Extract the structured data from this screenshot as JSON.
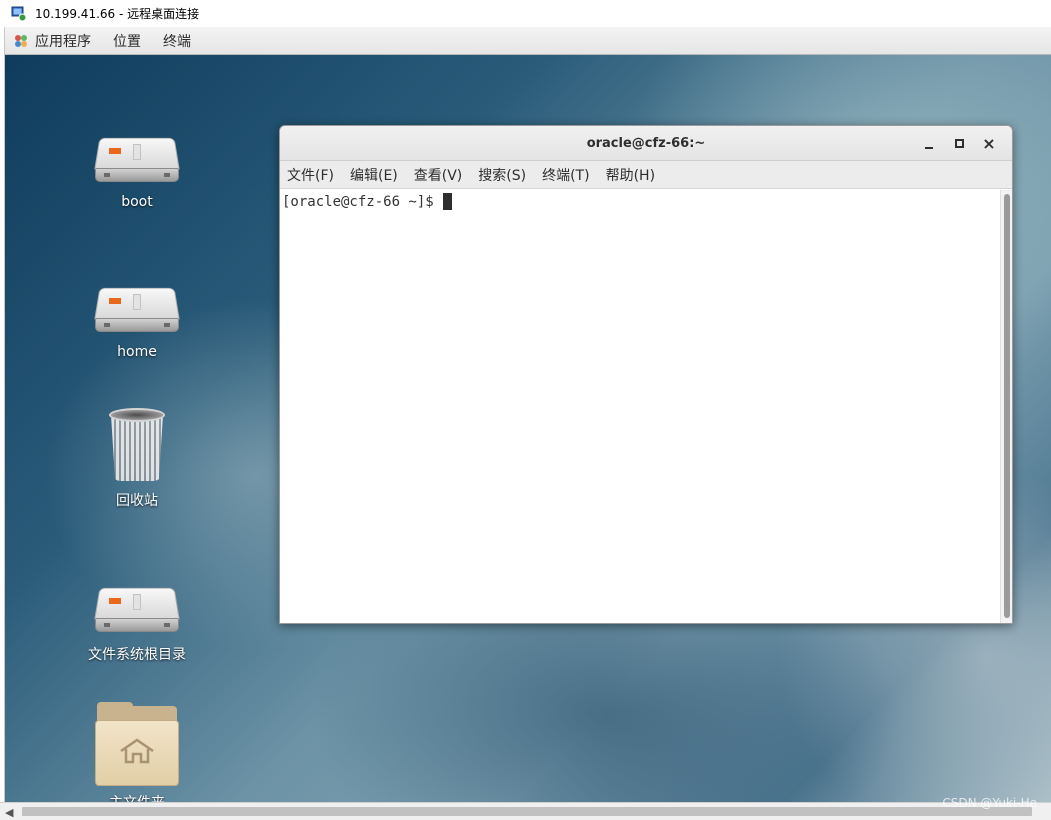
{
  "rdp_window": {
    "title": "10.199.41.66 - 远程桌面连接",
    "icon": "remote-desktop-icon"
  },
  "top_panel": {
    "items": [
      {
        "label": "应用程序",
        "icon": "applications-icon"
      },
      {
        "label": "位置"
      },
      {
        "label": "终端"
      }
    ]
  },
  "desktop": {
    "icons": [
      {
        "label": "boot",
        "icon": "drive-icon"
      },
      {
        "label": "home",
        "icon": "drive-icon"
      },
      {
        "label": "回收站",
        "icon": "trash-icon"
      },
      {
        "label": "文件系统根目录",
        "icon": "drive-icon"
      },
      {
        "label": "主文件夹",
        "icon": "home-folder-icon"
      }
    ]
  },
  "terminal": {
    "title": "oracle@cfz-66:~",
    "controls": {
      "minimize": "minimize-icon",
      "maximize": "maximize-icon",
      "close": "×"
    },
    "menu": [
      "文件(F)",
      "编辑(E)",
      "查看(V)",
      "搜索(S)",
      "终端(T)",
      "帮助(H)"
    ],
    "prompt": "[oracle@cfz-66 ~]$ "
  },
  "watermark": "CSDN @Yuki-He",
  "colors": {
    "accent_orange": "#e8681c",
    "desktop_dark": "#0f3c5c",
    "panel_bg": "#eeeeee"
  }
}
